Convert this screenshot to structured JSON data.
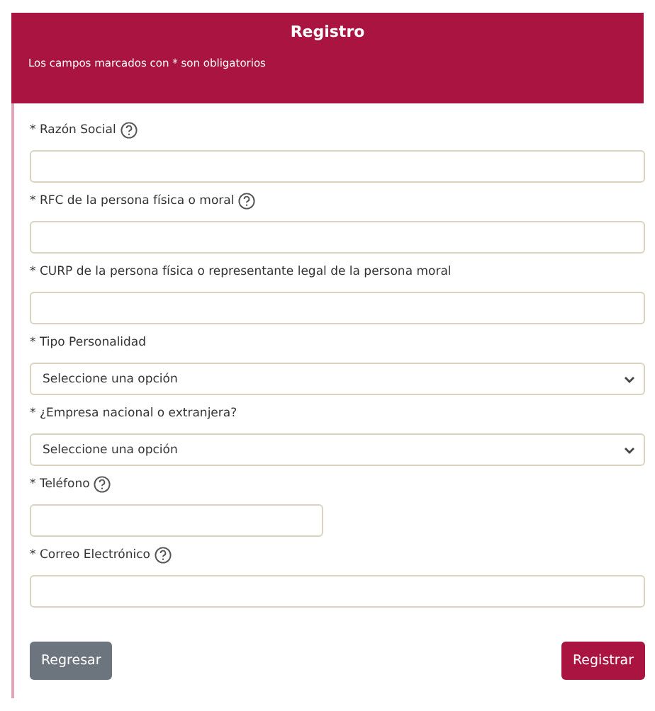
{
  "header": {
    "title": "Registro",
    "note": "Los campos marcados con * son obligatorios"
  },
  "fields": [
    {
      "label": "* Razón Social",
      "help": true,
      "kind": "text",
      "wide": true
    },
    {
      "label": "* RFC de la persona física o moral",
      "help": true,
      "kind": "text",
      "wide": true
    },
    {
      "label": "* CURP de la persona física o representante legal de la persona moral",
      "help": false,
      "kind": "text",
      "wide": true
    },
    {
      "label": "* Tipo Personalidad",
      "help": false,
      "kind": "select",
      "value": "Seleccione una opción",
      "wide": true
    },
    {
      "label": "* ¿Empresa nacional o extranjera?",
      "help": false,
      "kind": "select",
      "value": "Seleccione una opción",
      "wide": true
    },
    {
      "label": "* Teléfono",
      "help": true,
      "kind": "text",
      "wide": false
    },
    {
      "label": "* Correo Electrónico",
      "help": true,
      "kind": "text",
      "wide": true
    }
  ],
  "buttons": [
    {
      "label": "Regresar",
      "kind": "secondary"
    },
    {
      "label": "Registrar",
      "kind": "primary"
    }
  ]
}
